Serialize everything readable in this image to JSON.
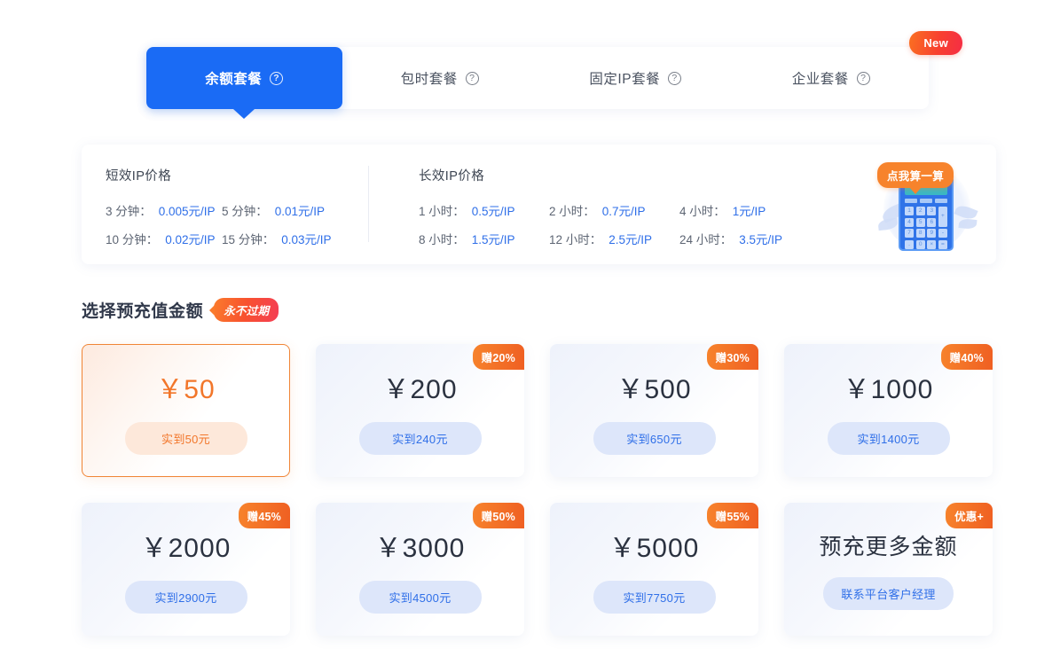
{
  "tabs": [
    {
      "label": "余额套餐",
      "active": true,
      "help_icon": "question-mark-icon"
    },
    {
      "label": "包时套餐",
      "active": false,
      "help_icon": "question-mark-icon"
    },
    {
      "label": "固定IP套餐",
      "active": false,
      "help_icon": "question-mark-icon"
    },
    {
      "label": "企业套餐",
      "active": false,
      "help_icon": "question-mark-icon",
      "badge": "New"
    }
  ],
  "tab_badge": "New",
  "price_panel": {
    "short": {
      "title": "短效IP价格",
      "items": [
        {
          "k": "3 分钟：",
          "v": "0.005元/IP"
        },
        {
          "k": "5 分钟：",
          "v": "0.01元/IP"
        },
        {
          "k": "10 分钟：",
          "v": "0.02元/IP"
        },
        {
          "k": "15 分钟：",
          "v": "0.03元/IP"
        }
      ]
    },
    "long": {
      "title": "长效IP价格",
      "items": [
        {
          "k": "1 小时：",
          "v": "0.5元/IP"
        },
        {
          "k": "2 小时：",
          "v": "0.7元/IP"
        },
        {
          "k": "4 小时：",
          "v": "1元/IP"
        },
        {
          "k": "8 小时：",
          "v": "1.5元/IP"
        },
        {
          "k": "12 小时：",
          "v": "2.5元/IP"
        },
        {
          "k": "24 小时：",
          "v": "3.5元/IP"
        }
      ]
    },
    "calculator": {
      "tooltip": "点我算一算",
      "icon": "calculator-icon",
      "keys": [
        "1",
        "2",
        "3",
        "+",
        "4",
        "5",
        "6",
        "7",
        "8",
        "9",
        "-",
        ".",
        "0",
        "×",
        "="
      ]
    }
  },
  "section": {
    "title": "选择预充值金额",
    "badge": "永不过期"
  },
  "cards": [
    {
      "amount": "￥50",
      "pill": "实到50元",
      "gift": "",
      "selected": true
    },
    {
      "amount": "￥200",
      "pill": "实到240元",
      "gift": "赠20%",
      "selected": false
    },
    {
      "amount": "￥500",
      "pill": "实到650元",
      "gift": "赠30%",
      "selected": false
    },
    {
      "amount": "￥1000",
      "pill": "实到1400元",
      "gift": "赠40%",
      "selected": false
    },
    {
      "amount": "￥2000",
      "pill": "实到2900元",
      "gift": "赠45%",
      "selected": false
    },
    {
      "amount": "￥3000",
      "pill": "实到4500元",
      "gift": "赠50%",
      "selected": false
    },
    {
      "amount": "￥5000",
      "pill": "实到7750元",
      "gift": "赠55%",
      "selected": false
    },
    {
      "amount": "预充更多金额",
      "pill": "联系平台客户经理",
      "gift": "优惠+",
      "selected": false,
      "contact": true
    }
  ],
  "colors": {
    "accent_blue": "#1a6bf5",
    "link_blue": "#2f6fe8",
    "accent_orange": "#f2762a",
    "badge_red": "#f52d45",
    "pill_blue_bg": "#dde6fa"
  }
}
